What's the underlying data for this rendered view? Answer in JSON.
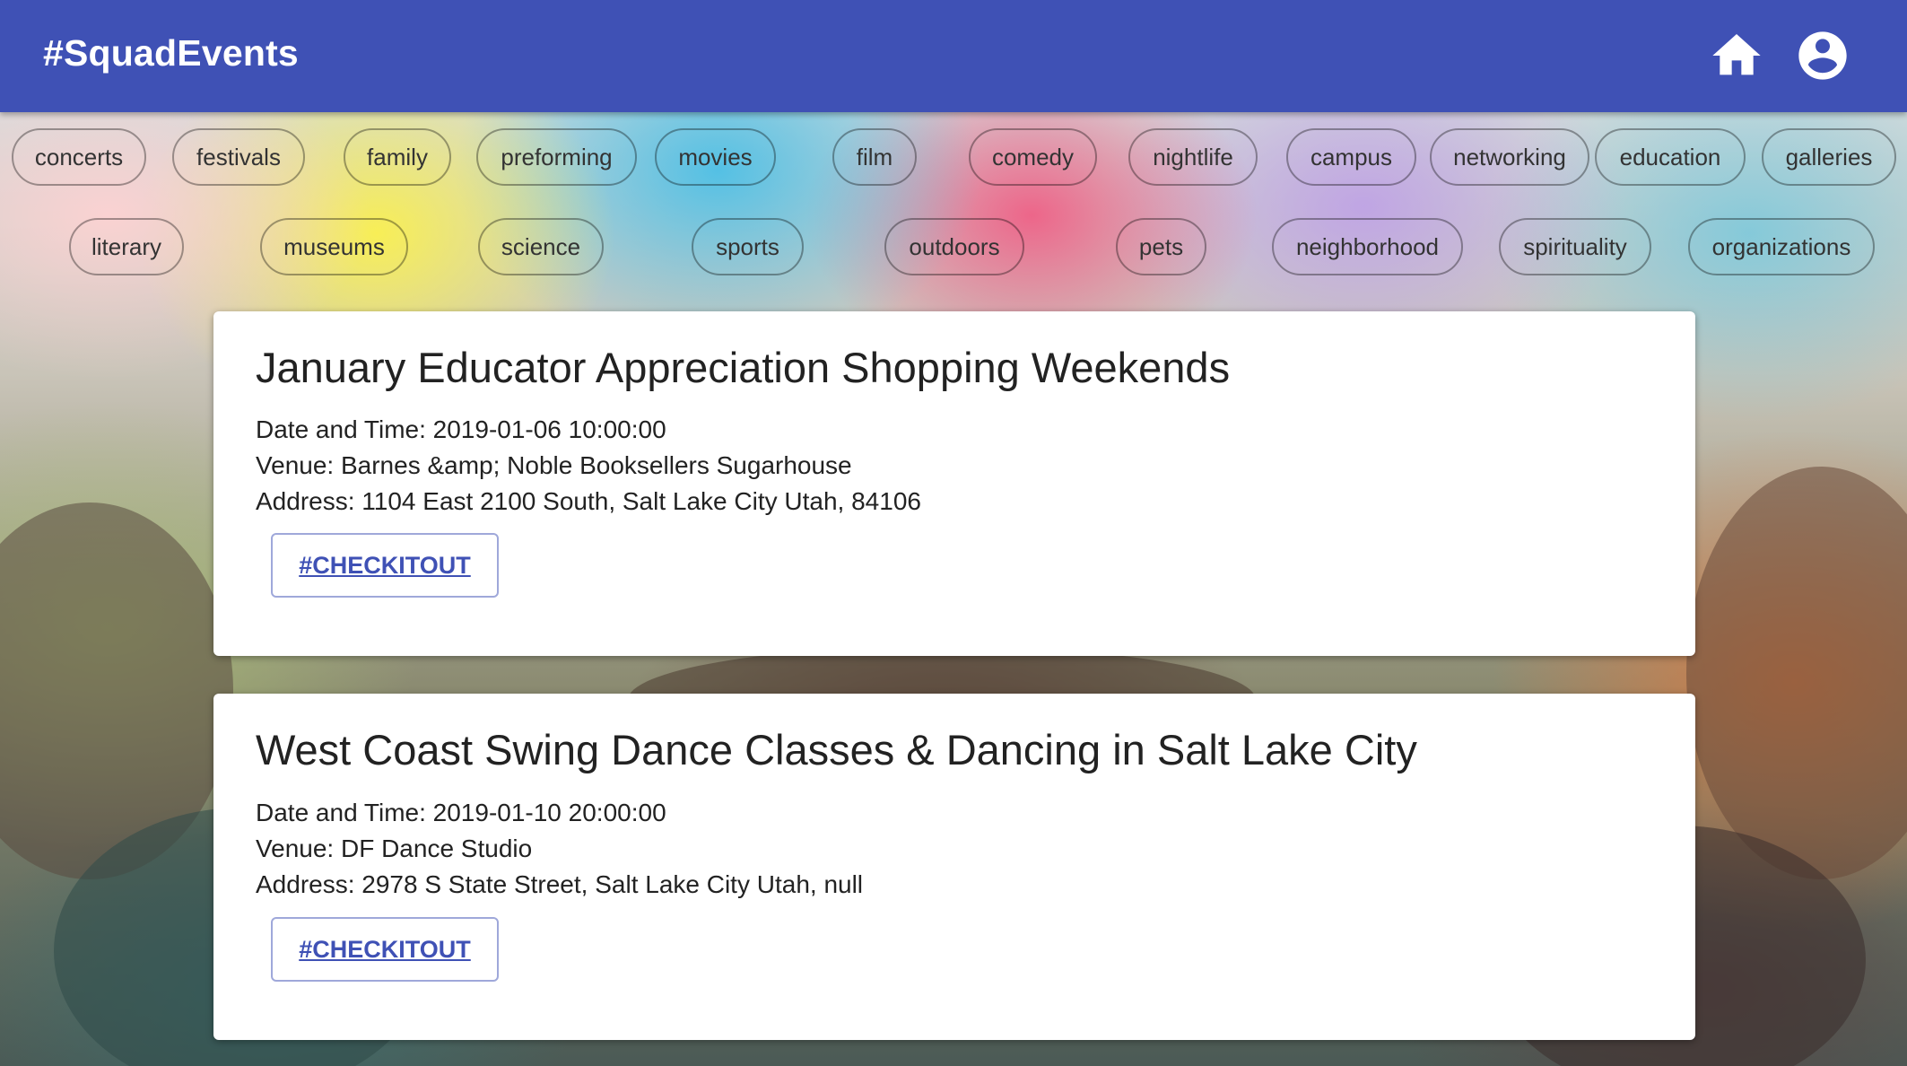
{
  "header": {
    "brand": "#SquadEvents",
    "home_icon": "home-icon",
    "account_icon": "account-circle-icon",
    "bar_color": "#3f51b5"
  },
  "categories": {
    "row1": [
      "concerts",
      "festivals",
      "family",
      "preforming",
      "movies",
      "film",
      "comedy",
      "nightlife",
      "campus",
      "networking",
      "education",
      "galleries"
    ],
    "row2": [
      "literary",
      "museums",
      "science",
      "sports",
      "outdoors",
      "pets",
      "neighborhood",
      "spirituality",
      "organizations"
    ]
  },
  "events": [
    {
      "title": "January Educator Appreciation Shopping Weekends",
      "datetime": "Date and Time: 2019-01-06 10:00:00",
      "venue": "Venue: Barnes &amp; Noble Booksellers Sugarhouse",
      "address": "Address: 1104 East 2100 South, Salt Lake City Utah, 84106",
      "button": "#CHECKITOUT"
    },
    {
      "title": "West Coast Swing Dance Classes & Dancing in Salt Lake City",
      "datetime": "Date and Time: 2019-01-10 20:00:00",
      "venue": "Venue: DF Dance Studio",
      "address": "Address: 2978 S State Street, Salt Lake City Utah, null",
      "button": "#CHECKITOUT"
    }
  ]
}
